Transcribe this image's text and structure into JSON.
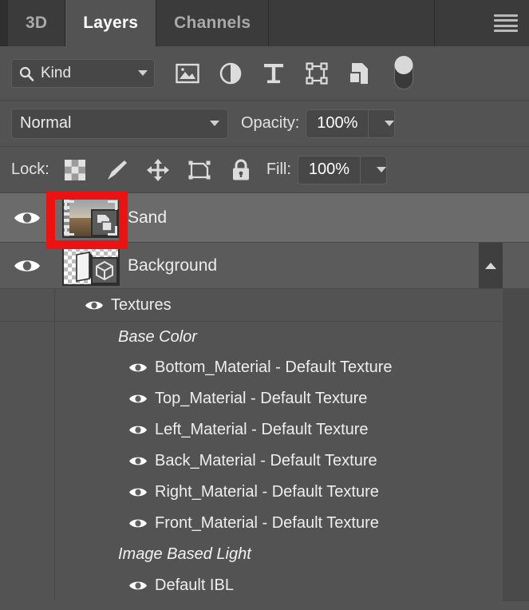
{
  "tabs": [
    {
      "label": "3D",
      "active": false
    },
    {
      "label": "Layers",
      "active": true
    },
    {
      "label": "Channels",
      "active": false
    }
  ],
  "panel_menu_icon": "hamburger-menu-icon",
  "filter": {
    "kind_label": "Kind",
    "search_icon": "search-icon",
    "dropdown_icon": "chevron-down-icon",
    "icons": [
      "pixel-layer-filter-icon",
      "adjustment-layer-filter-icon",
      "type-layer-filter-icon",
      "shape-layer-filter-icon",
      "smart-object-filter-icon",
      "filter-toggle-switch"
    ]
  },
  "blend": {
    "mode": "Normal",
    "opacity_label": "Opacity:",
    "opacity_value": "100%"
  },
  "lock": {
    "label": "Lock:",
    "icons": [
      "lock-transparent-pixels-icon",
      "lock-image-pixels-icon",
      "lock-position-icon",
      "lock-artboard-nesting-icon",
      "lock-all-icon"
    ],
    "fill_label": "Fill:",
    "fill_value": "100%"
  },
  "layers": [
    {
      "name": "Sand",
      "visible": true,
      "selected": true,
      "highlighted": true,
      "thumb": "smart-object-photo-thumbnail"
    },
    {
      "name": "Background",
      "visible": true,
      "selected": false,
      "highlighted": false,
      "thumb": "3d-layer-thumbnail",
      "collapsible": true
    }
  ],
  "tree": [
    {
      "label": "Textures",
      "type": "group",
      "eye": true,
      "indent": 0,
      "separator": false
    },
    {
      "label": "Base Color",
      "type": "section",
      "eye": false,
      "indent": 1,
      "separator": true
    },
    {
      "label": "Bottom_Material - Default Texture",
      "type": "item",
      "eye": true,
      "indent": 2,
      "separator": false
    },
    {
      "label": "Top_Material - Default Texture",
      "type": "item",
      "eye": true,
      "indent": 2,
      "separator": false
    },
    {
      "label": "Left_Material - Default Texture",
      "type": "item",
      "eye": true,
      "indent": 2,
      "separator": false
    },
    {
      "label": "Back_Material - Default Texture",
      "type": "item",
      "eye": true,
      "indent": 2,
      "separator": false
    },
    {
      "label": "Right_Material - Default Texture",
      "type": "item",
      "eye": true,
      "indent": 2,
      "separator": false
    },
    {
      "label": "Front_Material - Default Texture",
      "type": "item",
      "eye": true,
      "indent": 2,
      "separator": false
    },
    {
      "label": "Image Based Light",
      "type": "section",
      "eye": false,
      "indent": 1,
      "separator": false
    },
    {
      "label": "Default IBL",
      "type": "item",
      "eye": true,
      "indent": 2,
      "separator": false
    }
  ],
  "colors": {
    "panel_bg": "#535353",
    "tabbar_bg": "#2f2f2f",
    "tab_inactive_bg": "#3b3b3b",
    "selected_row_bg": "#6b6b6b",
    "highlight_box": "#ee1111",
    "text": "#eeeeee"
  }
}
